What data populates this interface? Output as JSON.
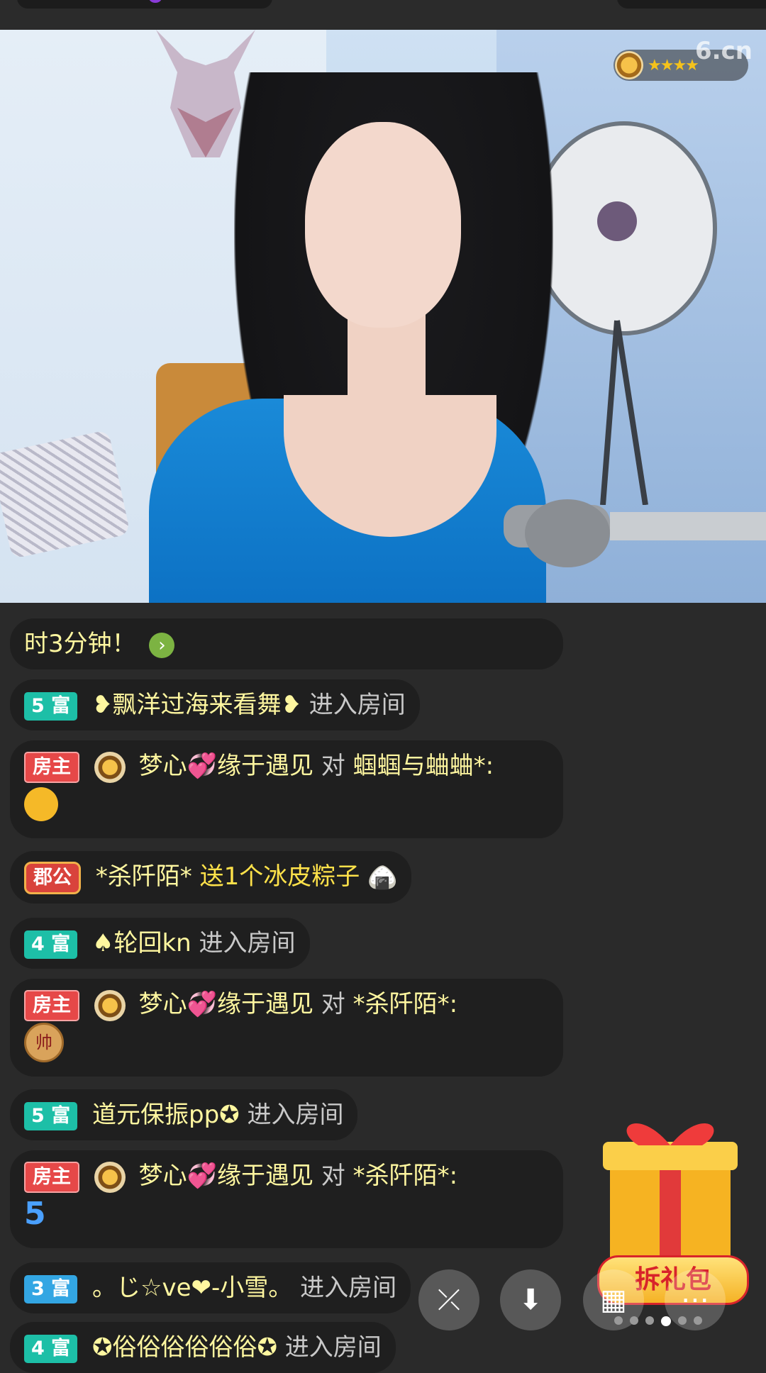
{
  "video": {
    "watermark": "6.cn",
    "badge_stars": "★★★★"
  },
  "chat": {
    "messages": [
      {
        "text": "时3分钟！"
      },
      {
        "tag": "5 富",
        "user": "❥飘洋过海来看舞❥",
        "action": "进入房间"
      },
      {
        "tag": "房主",
        "user": "梦心💞缘于遇见",
        "connector": "对",
        "target": "蝈蝈与蛐蛐*:"
      },
      {
        "tag": "郡公",
        "user": "*杀阡陌*",
        "action": "送1个冰皮粽子"
      },
      {
        "tag": "4 富",
        "user": "♠轮回kn",
        "action": "进入房间"
      },
      {
        "tag": "房主",
        "user": "梦心💞缘于遇见",
        "connector": "对",
        "target": "*杀阡陌*:",
        "emoji": "帅"
      },
      {
        "tag": "5 富",
        "user": "道元保振pp✪",
        "action": "进入房间"
      },
      {
        "tag": "房主",
        "user": "梦心💞缘于遇见",
        "connector": "对",
        "target": "*杀阡陌*:",
        "emoji": "5"
      },
      {
        "tag": "3 富",
        "user": "。じ☆ve❤-小雪。",
        "action": "进入房间"
      },
      {
        "tag": "4 富",
        "user": "✪俗俗俗俗俗俗✪",
        "action": "进入房间"
      }
    ]
  },
  "gift": {
    "label": "拆礼包"
  },
  "dock": {
    "icons": [
      "share-icon",
      "download-icon",
      "grid-icon",
      "more-icon"
    ]
  },
  "colors": {
    "background": "#2a2a2a",
    "bubble": "#1f1f1f",
    "rich_tag": "#1dbfa7",
    "host_tag": "#e64848"
  }
}
